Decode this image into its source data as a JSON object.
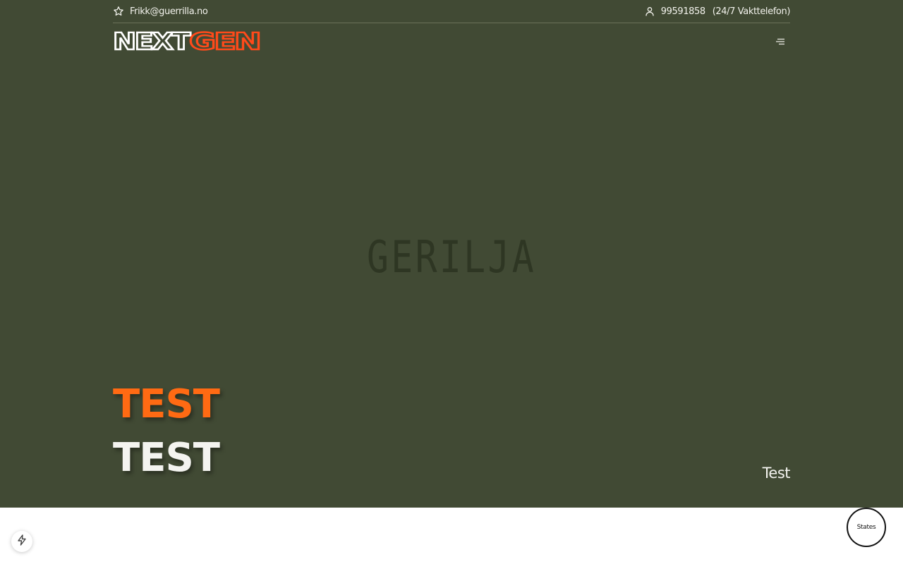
{
  "topbar": {
    "email": "Frikk@guerrilla.no",
    "phone": "99591858",
    "phone_note": "(24/7 Vakttelefon)"
  },
  "logo": {
    "text_white": "NEXT",
    "text_orange": "GEN"
  },
  "brand_mark": {
    "text": "GERILJA"
  },
  "hero": {
    "headline_1": "TEST",
    "headline_2": "TEST",
    "side_label": "Test"
  },
  "floating": {
    "states_label": "States"
  },
  "icons": {
    "email": "star-icon",
    "phone": "user-icon",
    "menu": "menu-icon",
    "dev": "lightning-icon"
  },
  "colors": {
    "hero_bg": "#414a34",
    "accent": "#ff6a13",
    "text_light": "#f4f4f0",
    "brand_mark": "#2e3623"
  }
}
